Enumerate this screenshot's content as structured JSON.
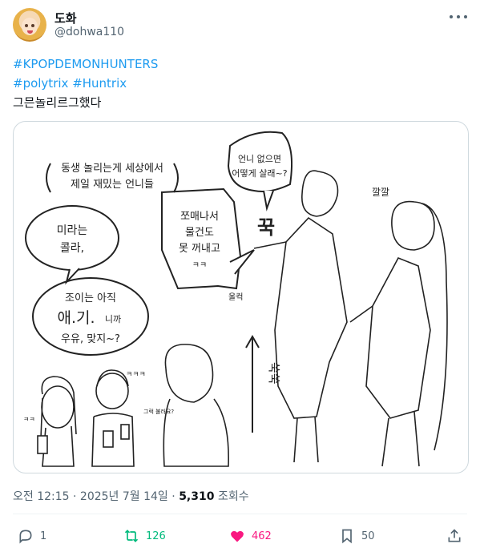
{
  "author": {
    "name": "도화",
    "handle": "@dohwa110"
  },
  "post": {
    "hashtags_line1": "#KPOPDEMONHUNTERS",
    "hashtag_polytrix": "#polytrix",
    "hashtag_huntrix": "#Huntrix",
    "body": "그믄놀리르그했다"
  },
  "illustration": {
    "bubble_top_left": [
      "동생 놀리는게 세상에서",
      "제일 재밌는 언니들"
    ],
    "bubble_mira": [
      "미라는",
      "콜라,"
    ],
    "bubble_zoey": [
      "조이는 아직",
      "애.기.",
      "니까",
      "우유, 맞지~?"
    ],
    "bubble_rumi": [
      "쪼매나서",
      "물건도",
      "못 꺼내고",
      "ㅋㅋ"
    ],
    "bubble_question": [
      "언니 없으면",
      "어떻게 살래~?"
    ],
    "sfx_kkwok": "꾹",
    "sfx_ulkeok": "울컥",
    "sfx_ssukssuk": "쑥쑥",
    "sfx_kkalkkal": "깔깔",
    "small_kk1": "ㅋㅋ",
    "small_kkk": "ㅋㅋㅋ",
    "small_whisper": "그럭 불러요?"
  },
  "meta": {
    "time": "오전 12:15",
    "date": "2025년 7월 14일",
    "views": "5,310",
    "views_label": "조회수"
  },
  "actions": {
    "replies": "1",
    "reposts": "126",
    "likes": "462",
    "bookmarks": "50"
  },
  "colors": {
    "link": "#1d9bf0",
    "repost": "#00ba7c",
    "like": "#f91880",
    "muted": "#536471"
  }
}
